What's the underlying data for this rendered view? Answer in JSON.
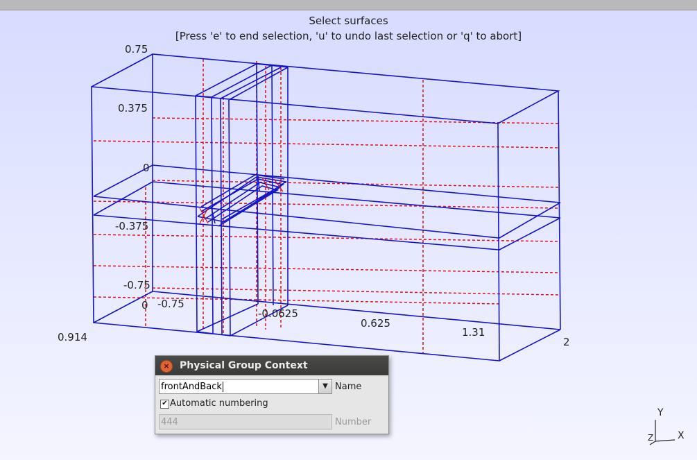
{
  "viewport": {
    "message_line1": "Select surfaces",
    "message_line2": "[Press 'e' to end selection, 'u' to undo last selection or 'q' to abort]",
    "ticks_y": [
      "0.75",
      "0.375",
      "0",
      "-0.375",
      "-0.75"
    ],
    "ticks_x": [
      "0",
      "-0.75",
      "-0.0625",
      "0.625",
      "1.31",
      "2"
    ],
    "tick_z": "0.914",
    "axes": {
      "y": "Y",
      "x": "X",
      "z": "Z"
    },
    "colors": {
      "mesh_edges": "#1515c8",
      "dashed_lines": "#e01010"
    }
  },
  "dialog": {
    "title": "Physical Group Context",
    "name_value": "frontAndBack",
    "name_label": "Name",
    "auto_numbering_checked": true,
    "auto_numbering_label": "Automatic numbering",
    "number_value": "444",
    "number_label": "Number"
  }
}
